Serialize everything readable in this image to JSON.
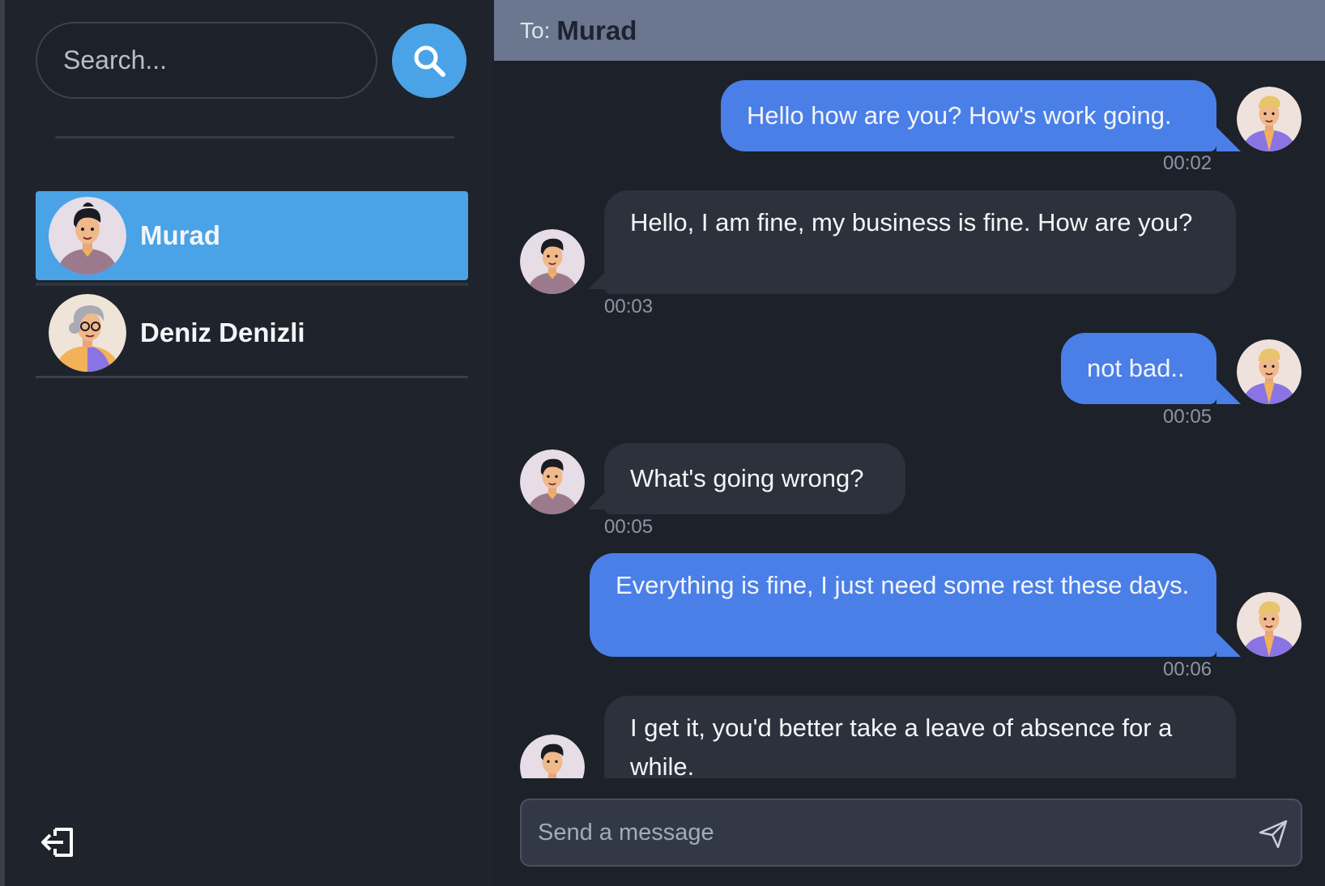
{
  "search": {
    "placeholder": "Search..."
  },
  "contacts": [
    {
      "name": "Murad",
      "active": true
    },
    {
      "name": "Deniz Denizli",
      "active": false
    }
  ],
  "header": {
    "to_label": "To:",
    "to_name": "Murad"
  },
  "messages": [
    {
      "direction": "out",
      "text": "Hello how are you? How's work going.",
      "time": "00:02"
    },
    {
      "direction": "in",
      "text": "Hello, I am fine, my business is fine. How are you?",
      "time": "00:03"
    },
    {
      "direction": "out",
      "text": "not bad..",
      "time": "00:05"
    },
    {
      "direction": "in",
      "text": "What's going wrong?",
      "time": "00:05"
    },
    {
      "direction": "out",
      "text": "Everything is fine, I just need some rest these days.",
      "time": "00:06"
    },
    {
      "direction": "in",
      "text": "I get it, you'd better take a leave of absence for a while.",
      "time": ""
    }
  ],
  "composer": {
    "placeholder": "Send a message"
  },
  "icons": {
    "search": "search-icon",
    "logout": "logout-icon",
    "send": "send-icon"
  },
  "colors": {
    "accent": "#4aa3e6",
    "outgoing_bubble": "#4a7fe8",
    "incoming_bubble": "#2c313b",
    "header": "#6a778e"
  }
}
